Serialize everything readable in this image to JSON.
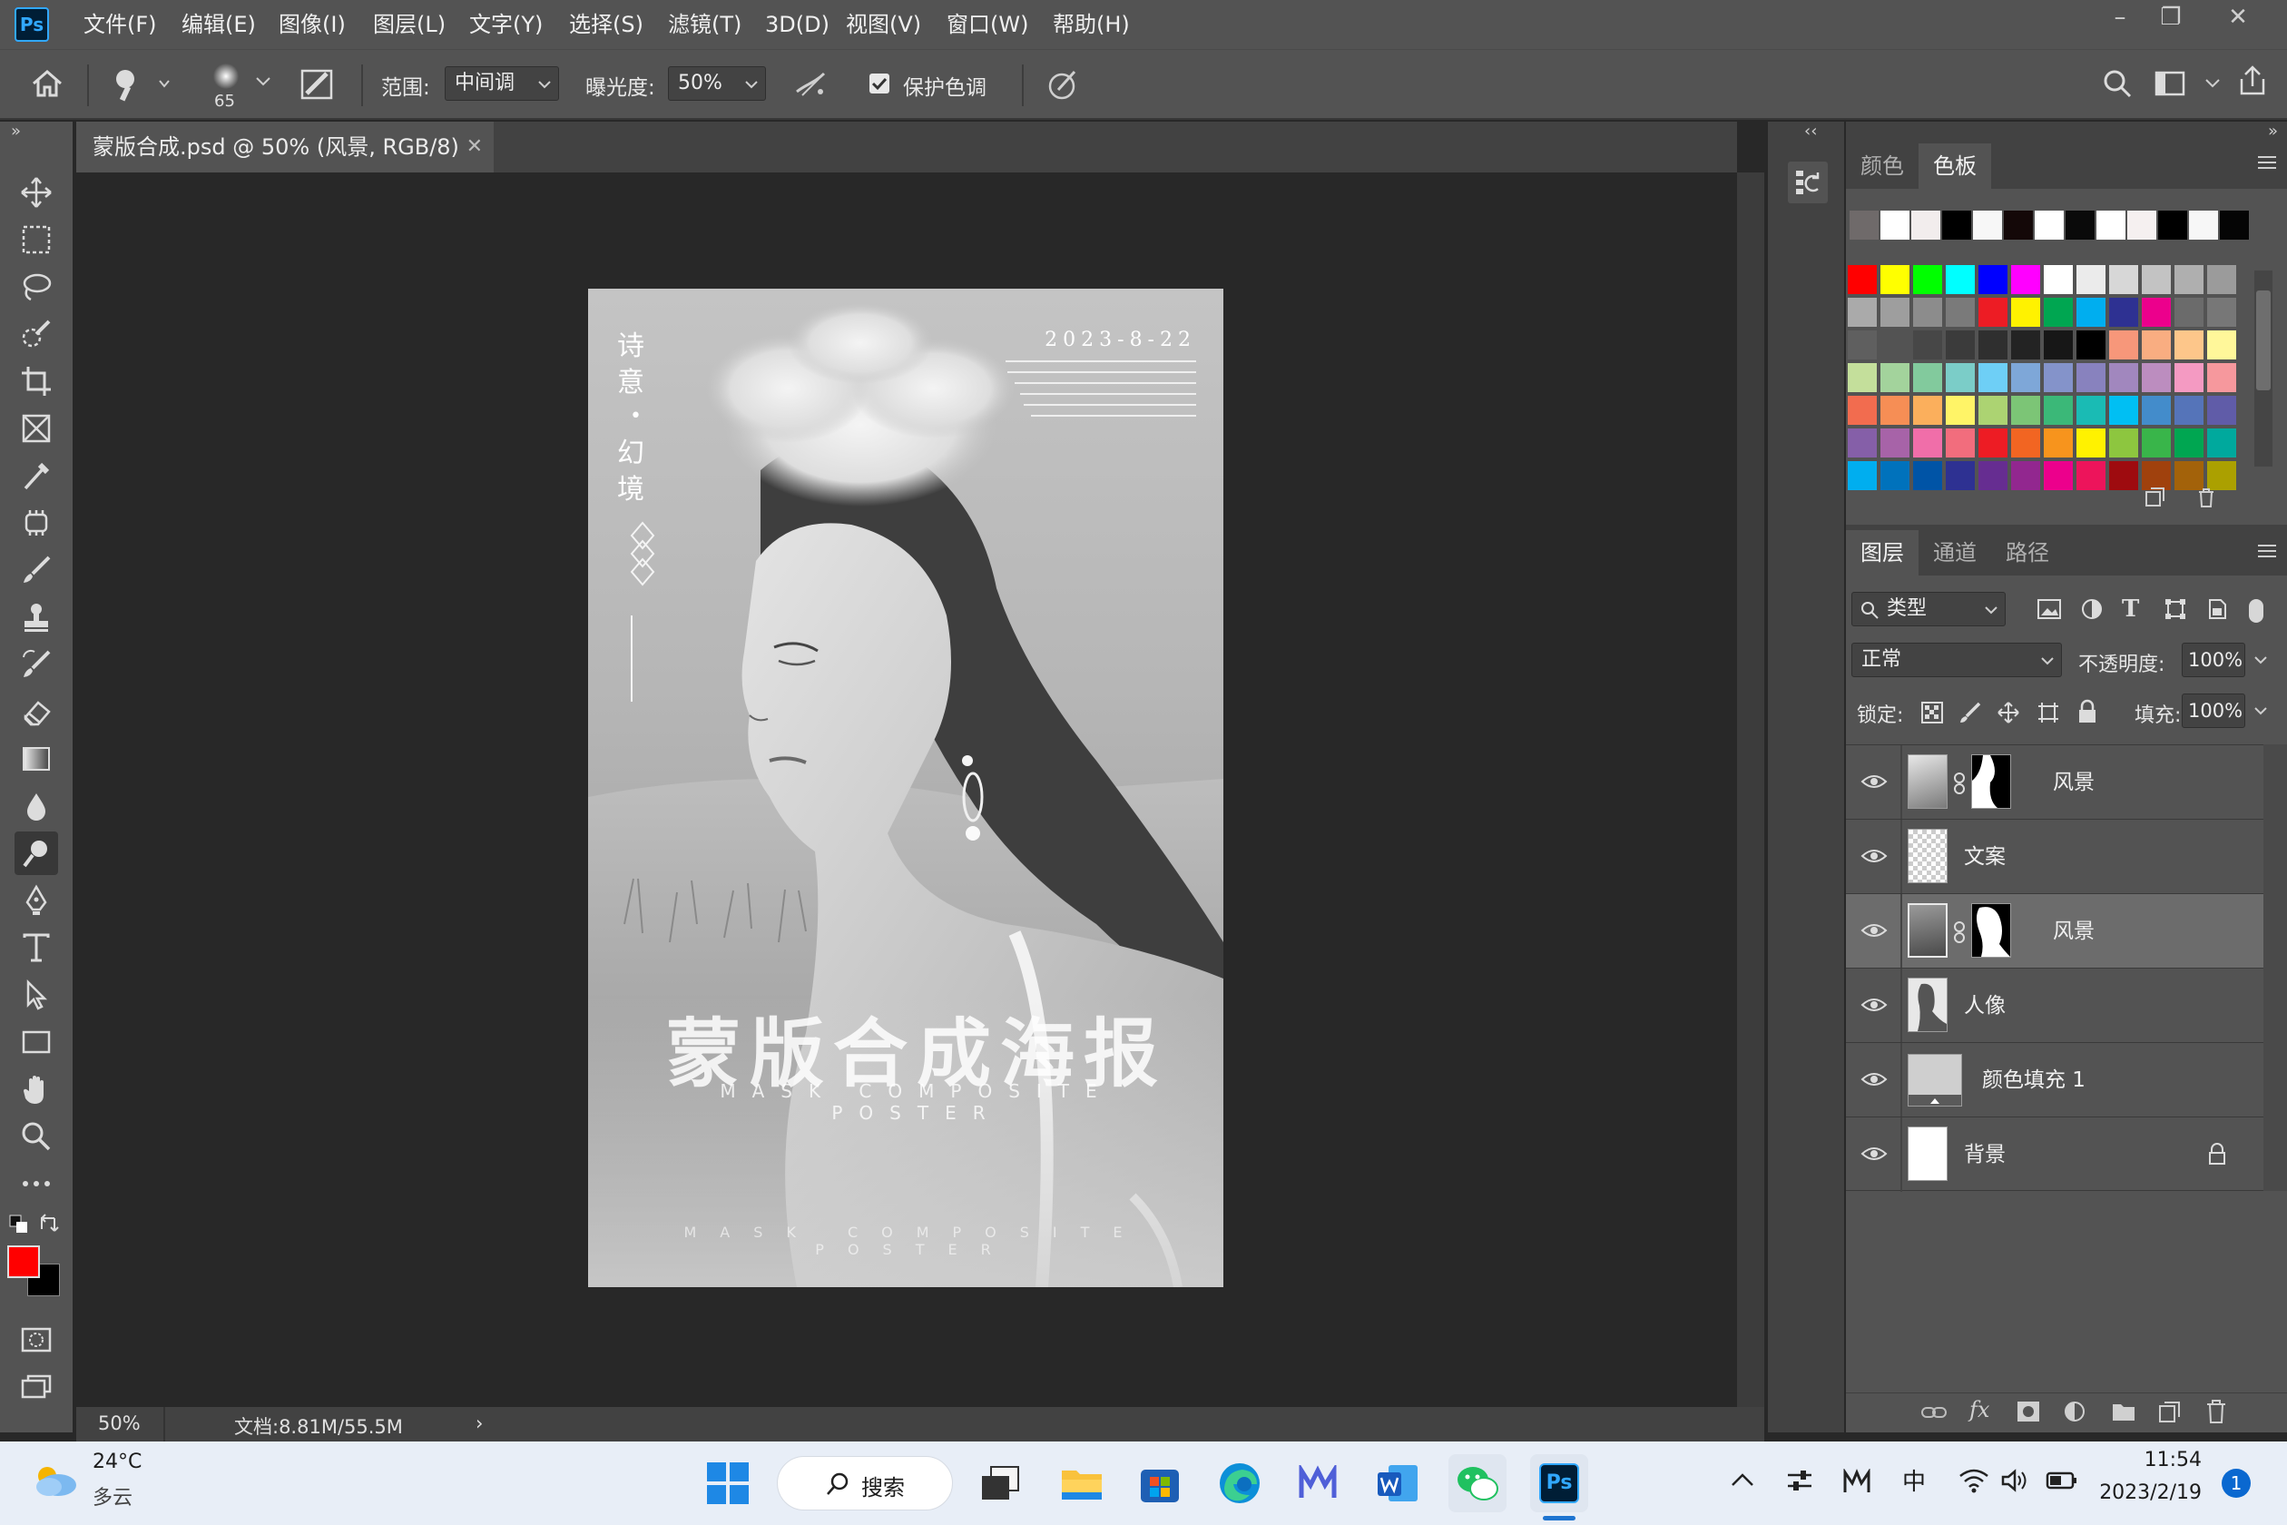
{
  "app": {
    "logo": "Ps"
  },
  "menu": [
    "文件(F)",
    "编辑(E)",
    "图像(I)",
    "图层(L)",
    "文字(Y)",
    "选择(S)",
    "滤镜(T)",
    "3D(D)",
    "视图(V)",
    "窗口(W)",
    "帮助(H)"
  ],
  "options": {
    "brush_size": "65",
    "range_label": "范围:",
    "range_value": "中间调",
    "exposure_label": "曝光度:",
    "exposure_value": "50%",
    "protect_label": "保护色调",
    "protect_checked": true
  },
  "document": {
    "tab_title": "蒙版合成.psd @ 50% (风景, RGB/8)",
    "zoom": "50%",
    "doc_info": "文档:8.81M/55.5M"
  },
  "poster": {
    "date": "2023-8-22",
    "vertical_title_top": "诗意",
    "vertical_dot": "•",
    "vertical_title_bottom": "幻境",
    "main_title": "蒙版合成海报",
    "subtitle": "MASK COMPOSITE POSTER",
    "footer": "MASK COMPOSITE POSTER"
  },
  "swatch_panel": {
    "tabs": [
      "颜色",
      "色板"
    ],
    "active_tab": "色板",
    "recent": [
      "#6f6a6a",
      "#ffffff",
      "#f2eded",
      "#000000",
      "#f7f7f7",
      "#140808",
      "#ffffff",
      "#0a0a0a",
      "#ffffff",
      "#f5f0f0",
      "#000000",
      "#f7f7f7",
      "#050505"
    ],
    "rows": [
      [
        "#ff0000",
        "#ffff00",
        "#00ff00",
        "#00ffff",
        "#0000ff",
        "#ff00ff",
        "#ffffff",
        "#ebebeb",
        "#d7d7d7",
        "#c3c3c3",
        "#afafaf",
        "#9b9b9b"
      ],
      [
        "#aaaaaa",
        "#9e9e9e",
        "#8c8c8c",
        "#7a7a7a",
        "#ed1c24",
        "#fff200",
        "#00a651",
        "#00aeef",
        "#2e3192",
        "#ec008c",
        "#6b6b6b",
        "#777777"
      ],
      [
        "#5f5f5f",
        "#535353",
        "#474747",
        "#3b3b3b",
        "#2f2f2f",
        "#232323",
        "#171717",
        "#000000",
        "#f7977a",
        "#f9ad81",
        "#fdc68a",
        "#fff79a"
      ],
      [
        "#c4df9b",
        "#a3d39c",
        "#82ca9d",
        "#7bcdc8",
        "#6ecff6",
        "#7ea7d8",
        "#8493ca",
        "#8882be",
        "#a187be",
        "#bc8dbf",
        "#f49ac2",
        "#f6989d"
      ],
      [
        "#f26c4f",
        "#f68e55",
        "#fbaf5c",
        "#fff467",
        "#acd372",
        "#7cc576",
        "#3bb878",
        "#1abbb4",
        "#00bff3",
        "#438ccb",
        "#5574b9",
        "#605ca8"
      ],
      [
        "#855fa8",
        "#a763a8",
        "#f06ea9",
        "#f26d7d",
        "#ed1c24",
        "#f26522",
        "#f7941d",
        "#fff200",
        "#8dc63f",
        "#39b54a",
        "#00a651",
        "#00a99d"
      ],
      [
        "#00aeef",
        "#0072bc",
        "#0054a6",
        "#2e3192",
        "#662d91",
        "#92278f",
        "#ec008c",
        "#ed145b",
        "#9e0b0f",
        "#a0410d",
        "#a3620a",
        "#aba000"
      ]
    ]
  },
  "layers_panel": {
    "tabs": [
      "图层",
      "通道",
      "路径"
    ],
    "active_tab": "图层",
    "filter": "类型",
    "blend_mode": "正常",
    "opacity_label": "不透明度:",
    "opacity": "100%",
    "lock_label": "锁定:",
    "fill_label": "填充:",
    "fill": "100%",
    "layers": [
      {
        "name": "风景",
        "has_mask": true,
        "selected": false
      },
      {
        "name": "文案",
        "has_mask": false,
        "selected": false
      },
      {
        "name": "风景",
        "has_mask": true,
        "selected": true
      },
      {
        "name": "人像",
        "has_mask": false,
        "selected": false
      },
      {
        "name": "颜色填充 1",
        "has_mask": false,
        "selected": false
      },
      {
        "name": "背景",
        "has_mask": false,
        "selected": false,
        "locked": true
      }
    ]
  },
  "colors": {
    "foreground": "#ff0000",
    "background": "#000000",
    "accent": "#31a8ff"
  },
  "taskbar": {
    "weather_temp": "24°C",
    "weather_desc": "多云",
    "search_label": "搜索",
    "ime": "中",
    "time": "11:54",
    "date": "2023/2/19",
    "notifications": "1"
  }
}
